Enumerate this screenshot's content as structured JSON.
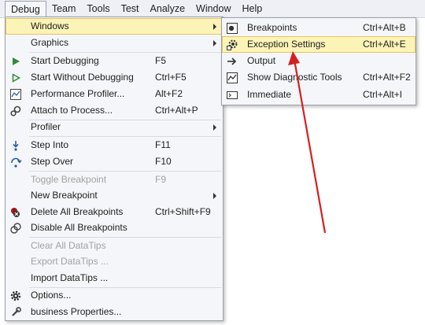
{
  "menubar": {
    "items": [
      "Debug",
      "Team",
      "Tools",
      "Test",
      "Analyze",
      "Window",
      "Help"
    ]
  },
  "debug_menu": {
    "windows": {
      "label": "Windows"
    },
    "graphics": {
      "label": "Graphics"
    },
    "start_debugging": {
      "label": "Start Debugging",
      "shortcut": "F5"
    },
    "start_without_debugging": {
      "label": "Start Without Debugging",
      "shortcut": "Ctrl+F5"
    },
    "performance_profiler": {
      "label": "Performance Profiler...",
      "shortcut": "Alt+F2"
    },
    "attach_to_process": {
      "label": "Attach to Process...",
      "shortcut": "Ctrl+Alt+P"
    },
    "profiler": {
      "label": "Profiler"
    },
    "step_into": {
      "label": "Step Into",
      "shortcut": "F11"
    },
    "step_over": {
      "label": "Step Over",
      "shortcut": "F10"
    },
    "toggle_breakpoint": {
      "label": "Toggle Breakpoint",
      "shortcut": "F9"
    },
    "new_breakpoint": {
      "label": "New Breakpoint"
    },
    "delete_all_breakpoints": {
      "label": "Delete All Breakpoints",
      "shortcut": "Ctrl+Shift+F9"
    },
    "disable_all_breakpoints": {
      "label": "Disable All Breakpoints"
    },
    "clear_all_datatips": {
      "label": "Clear All DataTips"
    },
    "export_datatips": {
      "label": "Export DataTips ..."
    },
    "import_datatips": {
      "label": "Import DataTips ..."
    },
    "options": {
      "label": "Options..."
    },
    "business_properties": {
      "label": "business Properties..."
    }
  },
  "windows_submenu": {
    "breakpoints": {
      "label": "Breakpoints",
      "shortcut": "Ctrl+Alt+B"
    },
    "exception_settings": {
      "label": "Exception Settings",
      "shortcut": "Ctrl+Alt+E"
    },
    "output": {
      "label": "Output"
    },
    "show_diagnostic_tools": {
      "label": "Show Diagnostic Tools",
      "shortcut": "Ctrl+Alt+F2"
    },
    "immediate": {
      "label": "Immediate",
      "shortcut": "Ctrl+Alt+I"
    }
  },
  "colors": {
    "highlight": "#fcf4b7",
    "annotation_arrow": "#d42020",
    "play_green": "#2e8b3a"
  }
}
